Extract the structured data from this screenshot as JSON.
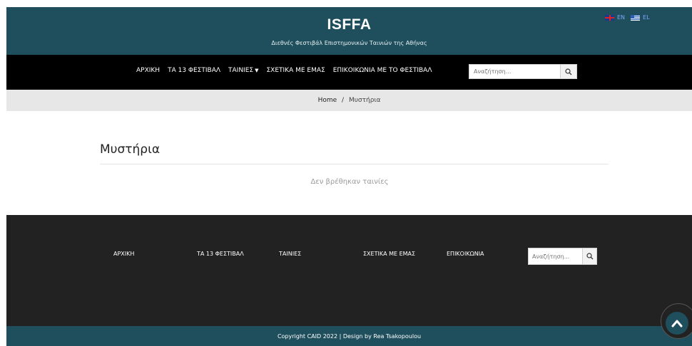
{
  "header": {
    "title": "ISFFA",
    "subtitle": "Διεθνές Φεστιβάλ Επιστημονικών Ταινιών της Αθήνας",
    "lang_en": "EN",
    "lang_el": "EL",
    "bg_color": "#1f4f5d"
  },
  "nav": {
    "items": [
      {
        "label": "ΑΡΧΙΚΗ"
      },
      {
        "label": "ΤΑ 13 ΦΕΣΤΙΒΑΛ"
      },
      {
        "label": "ΤΑΙΝΙΕΣ"
      },
      {
        "label": "ΣΧΕΤΙΚΑ ΜΕ ΕΜΑΣ"
      },
      {
        "label": "ΕΠΙΚΟΙΚΩΝΙΑ ΜΕ ΤΟ ΦΕΣΤΙΒΑΛ"
      }
    ],
    "search_placeholder": "Αναζήτηση..."
  },
  "breadcrumb": {
    "home": "Home",
    "separator": "/",
    "current": "Μυστήρια"
  },
  "main": {
    "title": "Μυστήρια",
    "empty_message": "Δεν βρέθηκαν ταινίες"
  },
  "footer": {
    "links": [
      {
        "label": "ΑΡΧΙΚΗ"
      },
      {
        "label": "ΤΑ 13 ΦΕΣΤΙΒΑΛ"
      },
      {
        "label": "ΤΑΙΝΙΕΣ"
      },
      {
        "label": "ΣΧΕΤΙΚΑ ΜΕ ΕΜΑΣ"
      },
      {
        "label": "ΕΠΙΚΟΙΚΩΝΙΑ"
      }
    ],
    "search_placeholder": "Αναζήτηση...",
    "copyright": "Copyright CAID 2022 | Design by Rea Tsakopoulou"
  },
  "icons": {
    "search": "search-icon",
    "caret": "caret-down-icon",
    "scroll_top": "chevron-up-icon"
  }
}
